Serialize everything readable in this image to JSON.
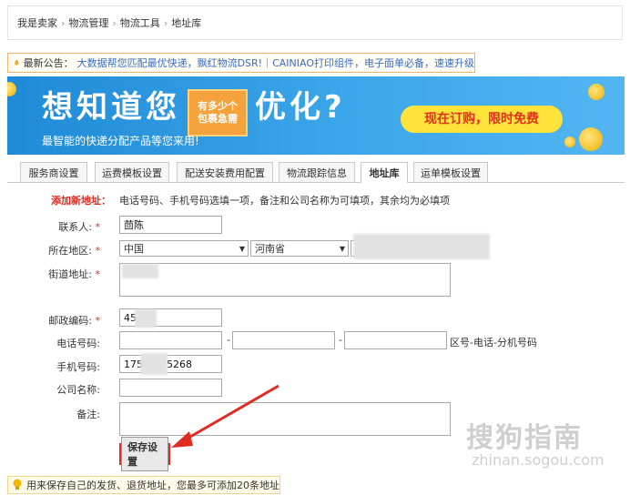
{
  "breadcrumb": {
    "items": [
      "我是卖家",
      "物流管理",
      "物流工具",
      "地址库"
    ],
    "sep": "›"
  },
  "notice": {
    "label": "最新公告：",
    "text": "大数据帮您匹配最优快递，飘红物流DSR!｜CAINIAO打印组件，电子面单必备，速速升级"
  },
  "banner": {
    "headline_left": "想知道您",
    "headline_right": "优化?",
    "box_text_1": "有多少个",
    "box_text_2": "包裹急需",
    "subtitle": "最智能的快递分配产品等您来用!",
    "cta": "现在订购，限时免费"
  },
  "tabs": [
    {
      "label": "服务商设置",
      "active": false
    },
    {
      "label": "运费模板设置",
      "active": false
    },
    {
      "label": "配送安装费用配置",
      "active": false
    },
    {
      "label": "物流跟踪信息",
      "active": false
    },
    {
      "label": "地址库",
      "active": true
    },
    {
      "label": "运单模板设置",
      "active": false
    }
  ],
  "form": {
    "section_title": "添加新地址：",
    "section_hint": "电话号码、手机号码选填一项，备注和公司名称为可填项，其余均为必填项",
    "required_mark": "*",
    "contact_label": "联系人:",
    "contact_value": "茴陈",
    "region_label": "所在地区:",
    "country_value": "中国",
    "province_value": "河南省",
    "street_label": "街道地址:",
    "zip_label": "邮政编码:",
    "zip_value": "45",
    "phone_label": "电话号码:",
    "phone_dash": "-",
    "phone_hint": "区号-电话-分机号码",
    "mobile_label": "手机号码:",
    "mobile_value_prefix": "175",
    "mobile_value_suffix": "5268",
    "company_label": "公司名称:",
    "remark_label": "备注:",
    "save_button": "保存设置",
    "select_arrow": "▼"
  },
  "tip": {
    "text": "用来保存自己的发货、退货地址，您最多可添加20条地址"
  },
  "watermark": {
    "line1": "搜狗指南",
    "line2": "zhinan.sogou.com"
  },
  "colors": {
    "required": "#e02b20",
    "notice_link": "#3a6cc0",
    "banner_blue": "#1f8ad6",
    "cta_yellow": "#ffe23a"
  }
}
